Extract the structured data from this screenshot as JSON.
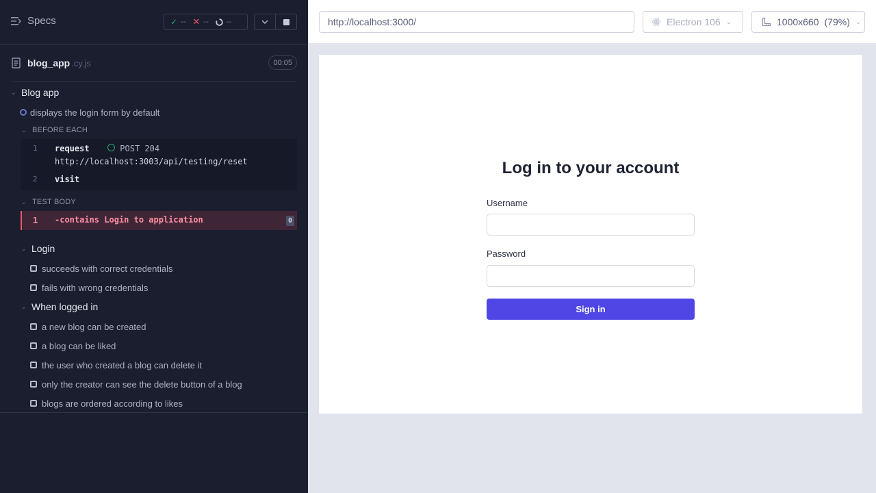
{
  "reporter": {
    "specs_label": "Specs",
    "stats": {
      "passed": "--",
      "failed": "--",
      "pending": "--"
    },
    "spec": {
      "name": "blog_app",
      "ext": ".cy.js",
      "duration": "00:05"
    },
    "root_suite": "Blog app",
    "active_test": "displays the login form by default",
    "hooks": {
      "before_each_label": "BEFORE EACH",
      "commands": [
        {
          "num": "1",
          "name": "request",
          "method": "POST 204",
          "url": "http://localhost:3003/api/testing/reset"
        },
        {
          "num": "2",
          "name": "visit"
        }
      ],
      "test_body_label": "TEST BODY",
      "failing_command": {
        "num": "1",
        "text": "-contains  Login to application",
        "count": "0"
      }
    },
    "login_suite": {
      "title": "Login",
      "tests": [
        "succeeds with correct credentials",
        "fails with wrong credentials"
      ]
    },
    "logged_in_suite": {
      "title": "When logged in",
      "tests": [
        "a new blog can be created",
        "a blog can be liked",
        "the user who created a blog can delete it",
        "only the creator can see the delete button of a blog",
        "blogs are ordered according to likes"
      ]
    }
  },
  "aut": {
    "url": "http://localhost:3000/",
    "browser": "Electron 106",
    "viewport": "1000x660",
    "scale": "(79%)",
    "page": {
      "title": "Log in to your account",
      "username_label": "Username",
      "password_label": "Password",
      "submit_label": "Sign in"
    }
  },
  "colors": {
    "accent": "#4f46e5",
    "pass": "#1fa971",
    "fail": "#e45770",
    "panel": "#1b1e2e"
  }
}
